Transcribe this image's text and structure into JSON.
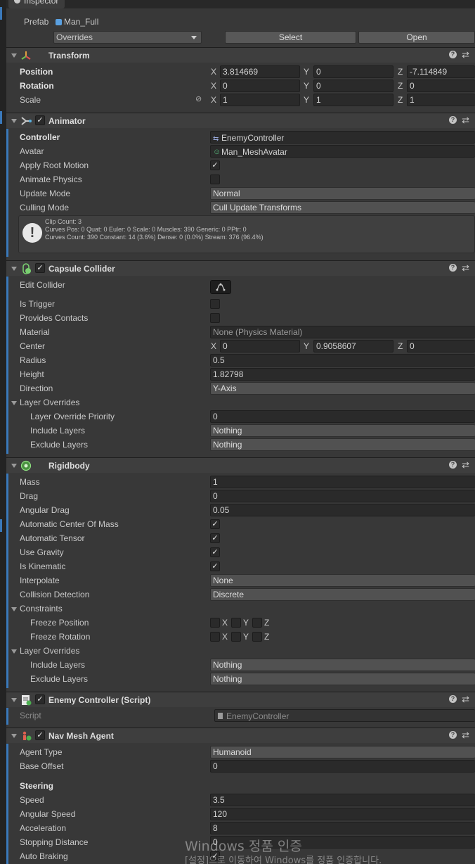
{
  "tab": {
    "title": "Inspector"
  },
  "prefab": {
    "label": "Prefab",
    "name": "Man_Full",
    "overrides": "Overrides",
    "select": "Select",
    "open": "Open"
  },
  "transform": {
    "title": "Transform",
    "position": {
      "label": "Position",
      "x": "3.814669",
      "y": "0",
      "z": "-7.114849"
    },
    "rotation": {
      "label": "Rotation",
      "x": "0",
      "y": "0",
      "z": "0"
    },
    "scale": {
      "label": "Scale",
      "x": "1",
      "y": "1",
      "z": "1"
    }
  },
  "axes": {
    "x": "X",
    "y": "Y",
    "z": "Z"
  },
  "animator": {
    "title": "Animator",
    "controller_label": "Controller",
    "controller": "EnemyController",
    "avatar_label": "Avatar",
    "avatar": "Man_MeshAvatar",
    "apply_root_motion": "Apply Root Motion",
    "animate_physics": "Animate Physics",
    "update_mode_label": "Update Mode",
    "update_mode": "Normal",
    "culling_mode_label": "Culling Mode",
    "culling_mode": "Cull Update Transforms",
    "info": [
      "Clip Count: 3",
      "Curves Pos: 0 Quat: 0 Euler: 0 Scale: 0 Muscles: 390 Generic: 0 PPtr: 0",
      "Curves Count: 390 Constant: 14 (3.6%) Dense: 0 (0.0%) Stream: 376 (96.4%)"
    ]
  },
  "capsule": {
    "title": "Capsule Collider",
    "edit_collider": "Edit Collider",
    "is_trigger": "Is Trigger",
    "provides_contacts": "Provides Contacts",
    "material_label": "Material",
    "material": "None (Physics Material)",
    "center_label": "Center",
    "center": {
      "x": "0",
      "y": "0.9058607",
      "z": "0"
    },
    "radius_label": "Radius",
    "radius": "0.5",
    "height_label": "Height",
    "height": "1.82798",
    "direction_label": "Direction",
    "direction": "Y-Axis",
    "layer_overrides": "Layer Overrides",
    "priority_label": "Layer Override Priority",
    "priority": "0",
    "include_label": "Include Layers",
    "include": "Nothing",
    "exclude_label": "Exclude Layers",
    "exclude": "Nothing"
  },
  "rigidbody": {
    "title": "Rigidbody",
    "mass_label": "Mass",
    "mass": "1",
    "drag_label": "Drag",
    "drag": "0",
    "angular_drag_label": "Angular Drag",
    "angular_drag": "0.05",
    "auto_center": "Automatic Center Of Mass",
    "auto_tensor": "Automatic Tensor",
    "use_gravity": "Use Gravity",
    "is_kinematic": "Is Kinematic",
    "interpolate_label": "Interpolate",
    "interpolate": "None",
    "collision_label": "Collision Detection",
    "collision": "Discrete",
    "constraints": "Constraints",
    "freeze_position": "Freeze Position",
    "freeze_rotation": "Freeze Rotation",
    "layer_overrides": "Layer Overrides",
    "include_label": "Include Layers",
    "include": "Nothing",
    "exclude_label": "Exclude Layers",
    "exclude": "Nothing"
  },
  "script": {
    "title": "Enemy Controller (Script)",
    "label": "Script",
    "value": "EnemyController"
  },
  "navmesh": {
    "title": "Nav Mesh Agent",
    "agent_type_label": "Agent Type",
    "agent_type": "Humanoid",
    "base_offset_label": "Base Offset",
    "base_offset": "0",
    "steering": "Steering",
    "speed_label": "Speed",
    "speed": "3.5",
    "angular_speed_label": "Angular Speed",
    "angular_speed": "120",
    "acceleration_label": "Acceleration",
    "acceleration": "8",
    "stopping_label": "Stopping Distance",
    "stopping": "0",
    "auto_braking": "Auto Braking"
  },
  "check_mark": "✓",
  "watermark": {
    "line1": "Windows 정품 인증",
    "line2": "[설정]으로 이동하여 Windows를 정품 인증합니다."
  }
}
